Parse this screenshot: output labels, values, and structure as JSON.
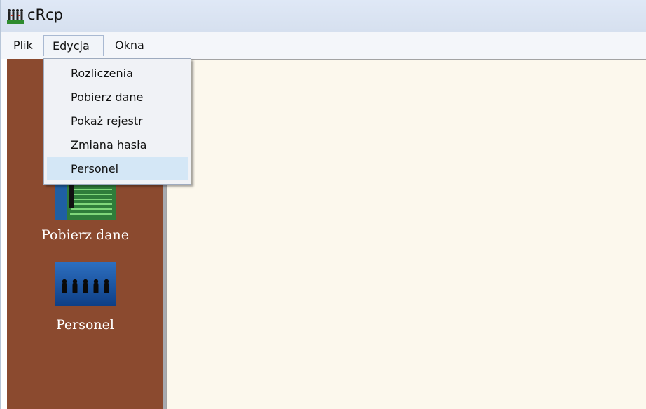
{
  "window": {
    "title": "cRcp",
    "icon": "app-people-icon"
  },
  "menubar": {
    "items": [
      {
        "label": "Plik"
      },
      {
        "label": "Edycja"
      },
      {
        "label": "Okna"
      }
    ],
    "open_menu": "Edycja"
  },
  "dropdown": {
    "items": [
      {
        "label": "Rozliczenia"
      },
      {
        "label": "Pobierz dane"
      },
      {
        "label": "Pokaż rejestr"
      },
      {
        "label": "Zmiana hasła"
      },
      {
        "label": "Personel"
      }
    ],
    "highlighted": "Personel"
  },
  "sidebar": {
    "background": "#8b4a2f",
    "tiles": [
      {
        "label": "Pobierz dane",
        "icon": "data-download-icon"
      },
      {
        "label": "Personel",
        "icon": "personnel-icon"
      }
    ]
  },
  "content": {
    "background": "#fcf8ed"
  }
}
